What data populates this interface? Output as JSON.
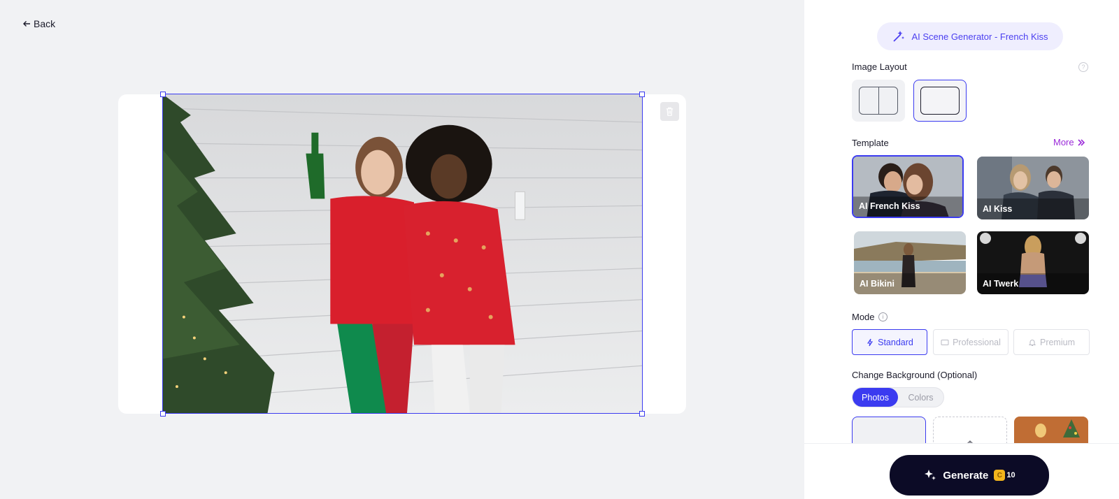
{
  "nav": {
    "back_label": "Back"
  },
  "scene": {
    "title": "AI Scene Generator - French Kiss"
  },
  "image_layout": {
    "label": "Image Layout",
    "selected": "single"
  },
  "template": {
    "label": "Template",
    "more_label": "More",
    "items": [
      {
        "label": "AI French Kiss",
        "selected": true
      },
      {
        "label": "AI Kiss",
        "selected": false
      },
      {
        "label": "AI Bikini",
        "selected": false
      },
      {
        "label": "AI Twerk",
        "selected": false
      }
    ]
  },
  "mode": {
    "label": "Mode",
    "options": [
      {
        "label": "Standard",
        "selected": true
      },
      {
        "label": "Professional",
        "selected": false
      },
      {
        "label": "Premium",
        "selected": false
      }
    ]
  },
  "background": {
    "label": "Change Background (Optional)",
    "tabs": [
      {
        "label": "Photos",
        "selected": true
      },
      {
        "label": "Colors",
        "selected": false
      }
    ]
  },
  "generate": {
    "label": "Generate",
    "cost": "10"
  },
  "colors": {
    "accent": "#3b3bf0",
    "generate_bg": "#0c0b26",
    "more_link": "#9b2bd9"
  }
}
